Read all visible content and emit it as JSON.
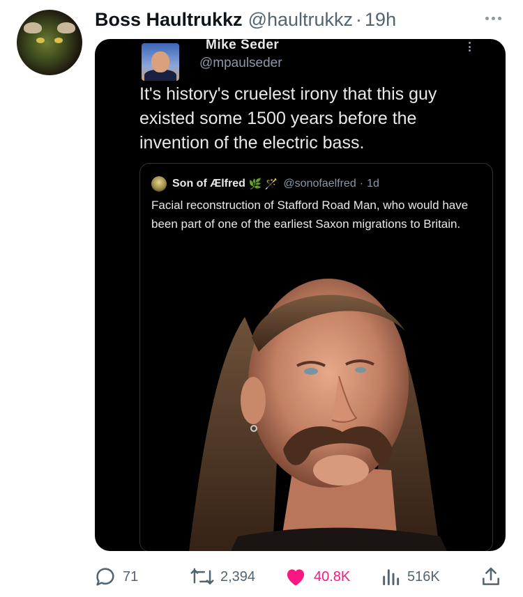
{
  "tweet": {
    "author_name": "Boss Haultrukkz",
    "author_handle": "@haultrukkz",
    "separator": "·",
    "time": "19h"
  },
  "embedded_tweet": {
    "author_name": "Mike Seder",
    "author_handle": "@mpaulseder",
    "text": "It's history's cruelest irony that this guy existed some 1500 years before the invention of the electric bass."
  },
  "quoted_tweet": {
    "author_name": "Son of Ælfred",
    "author_emoji": "🌿 🪄",
    "author_handle": "@sonofaelfred",
    "separator": "·",
    "time": "1d",
    "text": "Facial reconstruction of Stafford Road Man, who would have been part of one of the earliest Saxon migrations to Britain."
  },
  "actions": {
    "replies": "71",
    "retweets": "2,394",
    "likes": "40.8K",
    "views": "516K"
  },
  "colors": {
    "like": "#f91880",
    "muted": "#536471",
    "card_bg": "#000000"
  }
}
